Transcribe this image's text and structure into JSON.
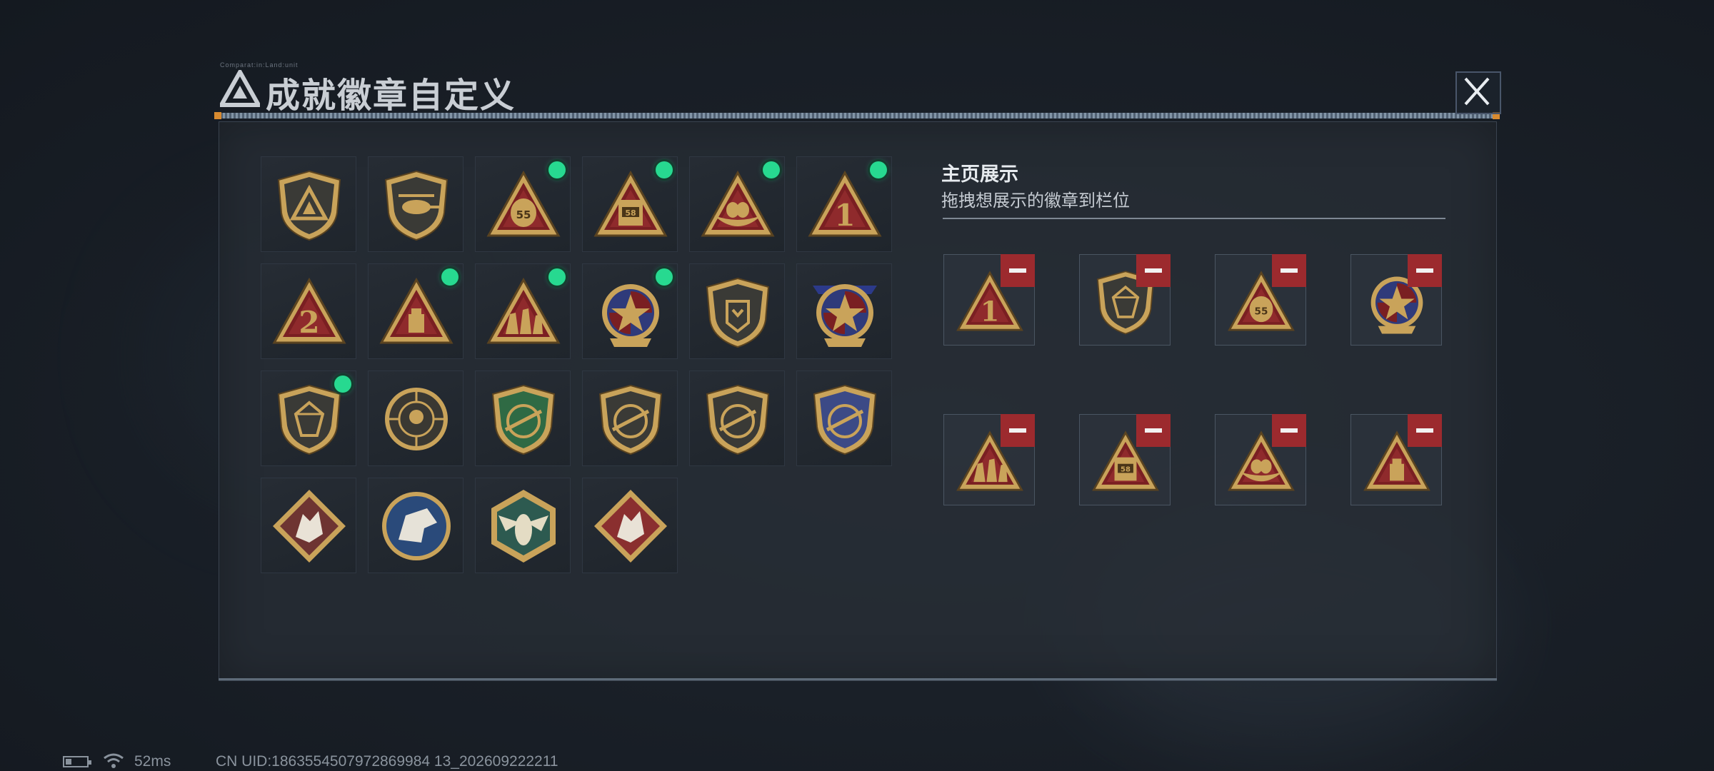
{
  "header": {
    "title": "成就徽章自定义",
    "microtext": "Comparat:in:Land:unit",
    "logo_icon": "triangle-a-logo-icon",
    "close_icon": "close-x-icon"
  },
  "colors": {
    "new_indicator": "#27d990",
    "remove_button": "#9c2a2e",
    "badge_gold": "#c9a35a",
    "badge_red": "#7a1f22"
  },
  "badges": [
    {
      "icon": "shield-triangle-badge-icon",
      "is_new": false
    },
    {
      "icon": "helicopter-shield-badge-icon",
      "is_new": false
    },
    {
      "icon": "money-bag-55-triangle-badge-icon",
      "is_new": true,
      "label": "55"
    },
    {
      "icon": "machine-58-triangle-badge-icon",
      "is_new": true,
      "label": "58"
    },
    {
      "icon": "egg-nest-triangle-badge-icon",
      "is_new": true
    },
    {
      "icon": "number-1-triangle-badge-icon",
      "is_new": true,
      "label": "1"
    },
    {
      "icon": "number-2-triangle-badge-icon",
      "is_new": false,
      "label": "2"
    },
    {
      "icon": "drive-triangle-badge-icon",
      "is_new": true
    },
    {
      "icon": "soldiers-triangle-badge-icon",
      "is_new": true
    },
    {
      "icon": "star-medallion-badge-icon",
      "is_new": true
    },
    {
      "icon": "emblem-shield-badge-icon",
      "is_new": false
    },
    {
      "icon": "ribbon-emblem-badge-icon",
      "is_new": false
    },
    {
      "icon": "gem-shield-badge-icon",
      "is_new": true
    },
    {
      "icon": "crosshair-skull-badge-icon",
      "is_new": false
    },
    {
      "icon": "rifle-green-shield-badge-icon",
      "is_new": false
    },
    {
      "icon": "smg-shield-badge-icon",
      "is_new": false
    },
    {
      "icon": "sniper-shield-badge-icon",
      "is_new": false
    },
    {
      "icon": "crossed-rifles-blue-shield-badge-icon",
      "is_new": false
    },
    {
      "icon": "wolf-diamond-badge-icon",
      "is_new": false
    },
    {
      "icon": "eagle-circle-badge-icon",
      "is_new": false
    },
    {
      "icon": "hornet-hexagon-badge-icon",
      "is_new": false
    },
    {
      "icon": "dragon-diamond-badge-icon",
      "is_new": false
    }
  ],
  "display": {
    "title": "主页展示",
    "subtitle": "拖拽想展示的徽章到栏位",
    "slots": [
      {
        "icon": "number-1-triangle-badge-icon",
        "label": "1"
      },
      {
        "icon": "gem-shield-badge-icon"
      },
      {
        "icon": "money-bag-55-triangle-badge-icon",
        "label": "55"
      },
      {
        "icon": "star-medallion-badge-icon"
      },
      {
        "icon": "soldiers-triangle-badge-icon"
      },
      {
        "icon": "machine-58-triangle-badge-icon",
        "label": "58"
      },
      {
        "icon": "egg-nest-triangle-badge-icon"
      },
      {
        "icon": "drive-triangle-badge-icon"
      }
    ]
  },
  "status_bar": {
    "battery_icon": "battery-low-icon",
    "wifi_icon": "wifi-icon",
    "ping": "52ms",
    "uid": "CN UID:1863554507972869984 13_202609222211"
  }
}
